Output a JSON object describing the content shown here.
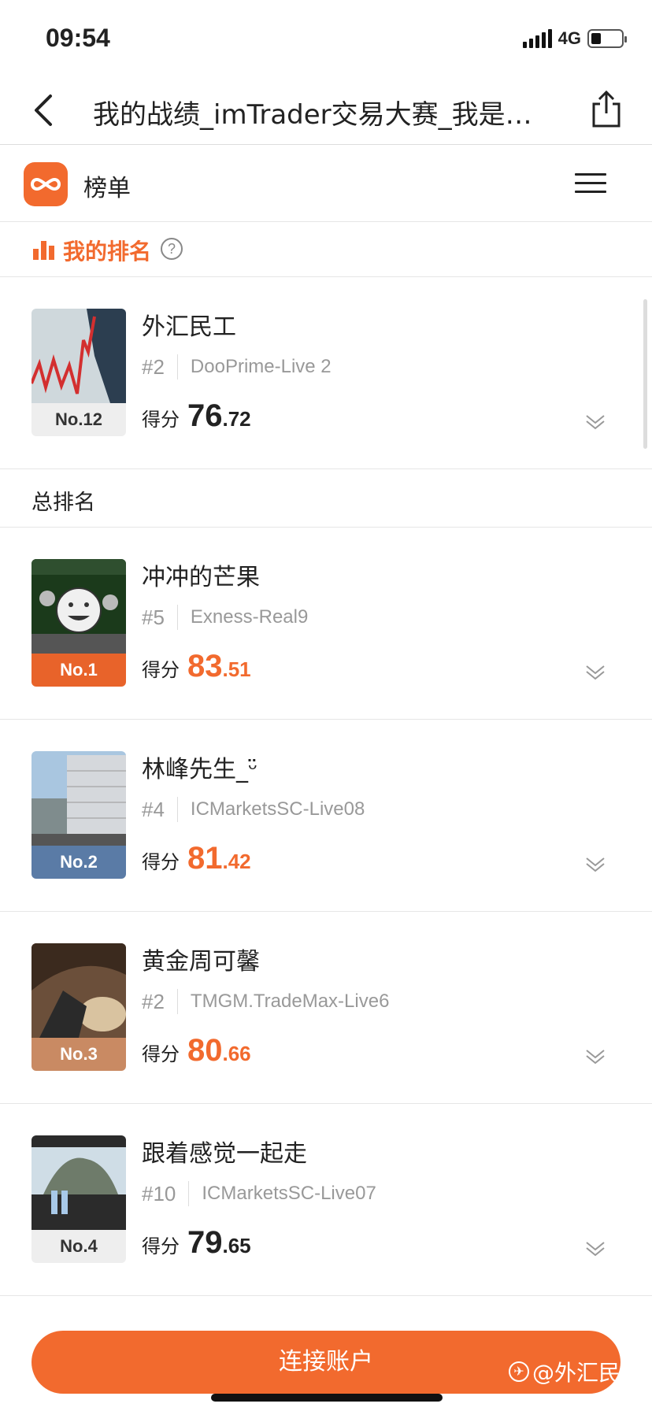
{
  "status_bar": {
    "time": "09:54",
    "network": "4G"
  },
  "nav": {
    "title": "我的战绩_imTrader交易大赛_我是…"
  },
  "app_header": {
    "title": "榜单"
  },
  "my_rank": {
    "label": "我的排名",
    "help": "?"
  },
  "my_entry": {
    "name": "外汇民工",
    "position": "#2",
    "server": "DooPrime-Live 2",
    "rank": "No.12",
    "score_label": "得分",
    "score_int": "76",
    "score_dec": ".72"
  },
  "section": {
    "label": "总排名"
  },
  "leaderboard": [
    {
      "name": "冲冲的芒果",
      "position": "#5",
      "server": "Exness-Real9",
      "rank": "No.1",
      "score_label": "得分",
      "score_int": "83",
      "score_dec": ".51"
    },
    {
      "name": "林峰先生_ᵕ̈",
      "position": "#4",
      "server": "ICMarketsSC-Live08",
      "rank": "No.2",
      "score_label": "得分",
      "score_int": "81",
      "score_dec": ".42"
    },
    {
      "name": "黄金周可馨",
      "position": "#2",
      "server": "TMGM.TradeMax-Live6",
      "rank": "No.3",
      "score_label": "得分",
      "score_int": "80",
      "score_dec": ".66"
    },
    {
      "name": "跟着感觉一起走",
      "position": "#10",
      "server": "ICMarketsSC-Live07",
      "rank": "No.4",
      "score_label": "得分",
      "score_int": "79",
      "score_dec": ".65"
    }
  ],
  "bottom": {
    "connect_label": "连接账户",
    "watermark": "@外汇民工"
  },
  "colors": {
    "accent": "#f26a2e",
    "gold": "#e8632a",
    "silver": "#5a7ba6",
    "bronze": "#c98a63",
    "neutral_badge": "#eeeeee"
  }
}
